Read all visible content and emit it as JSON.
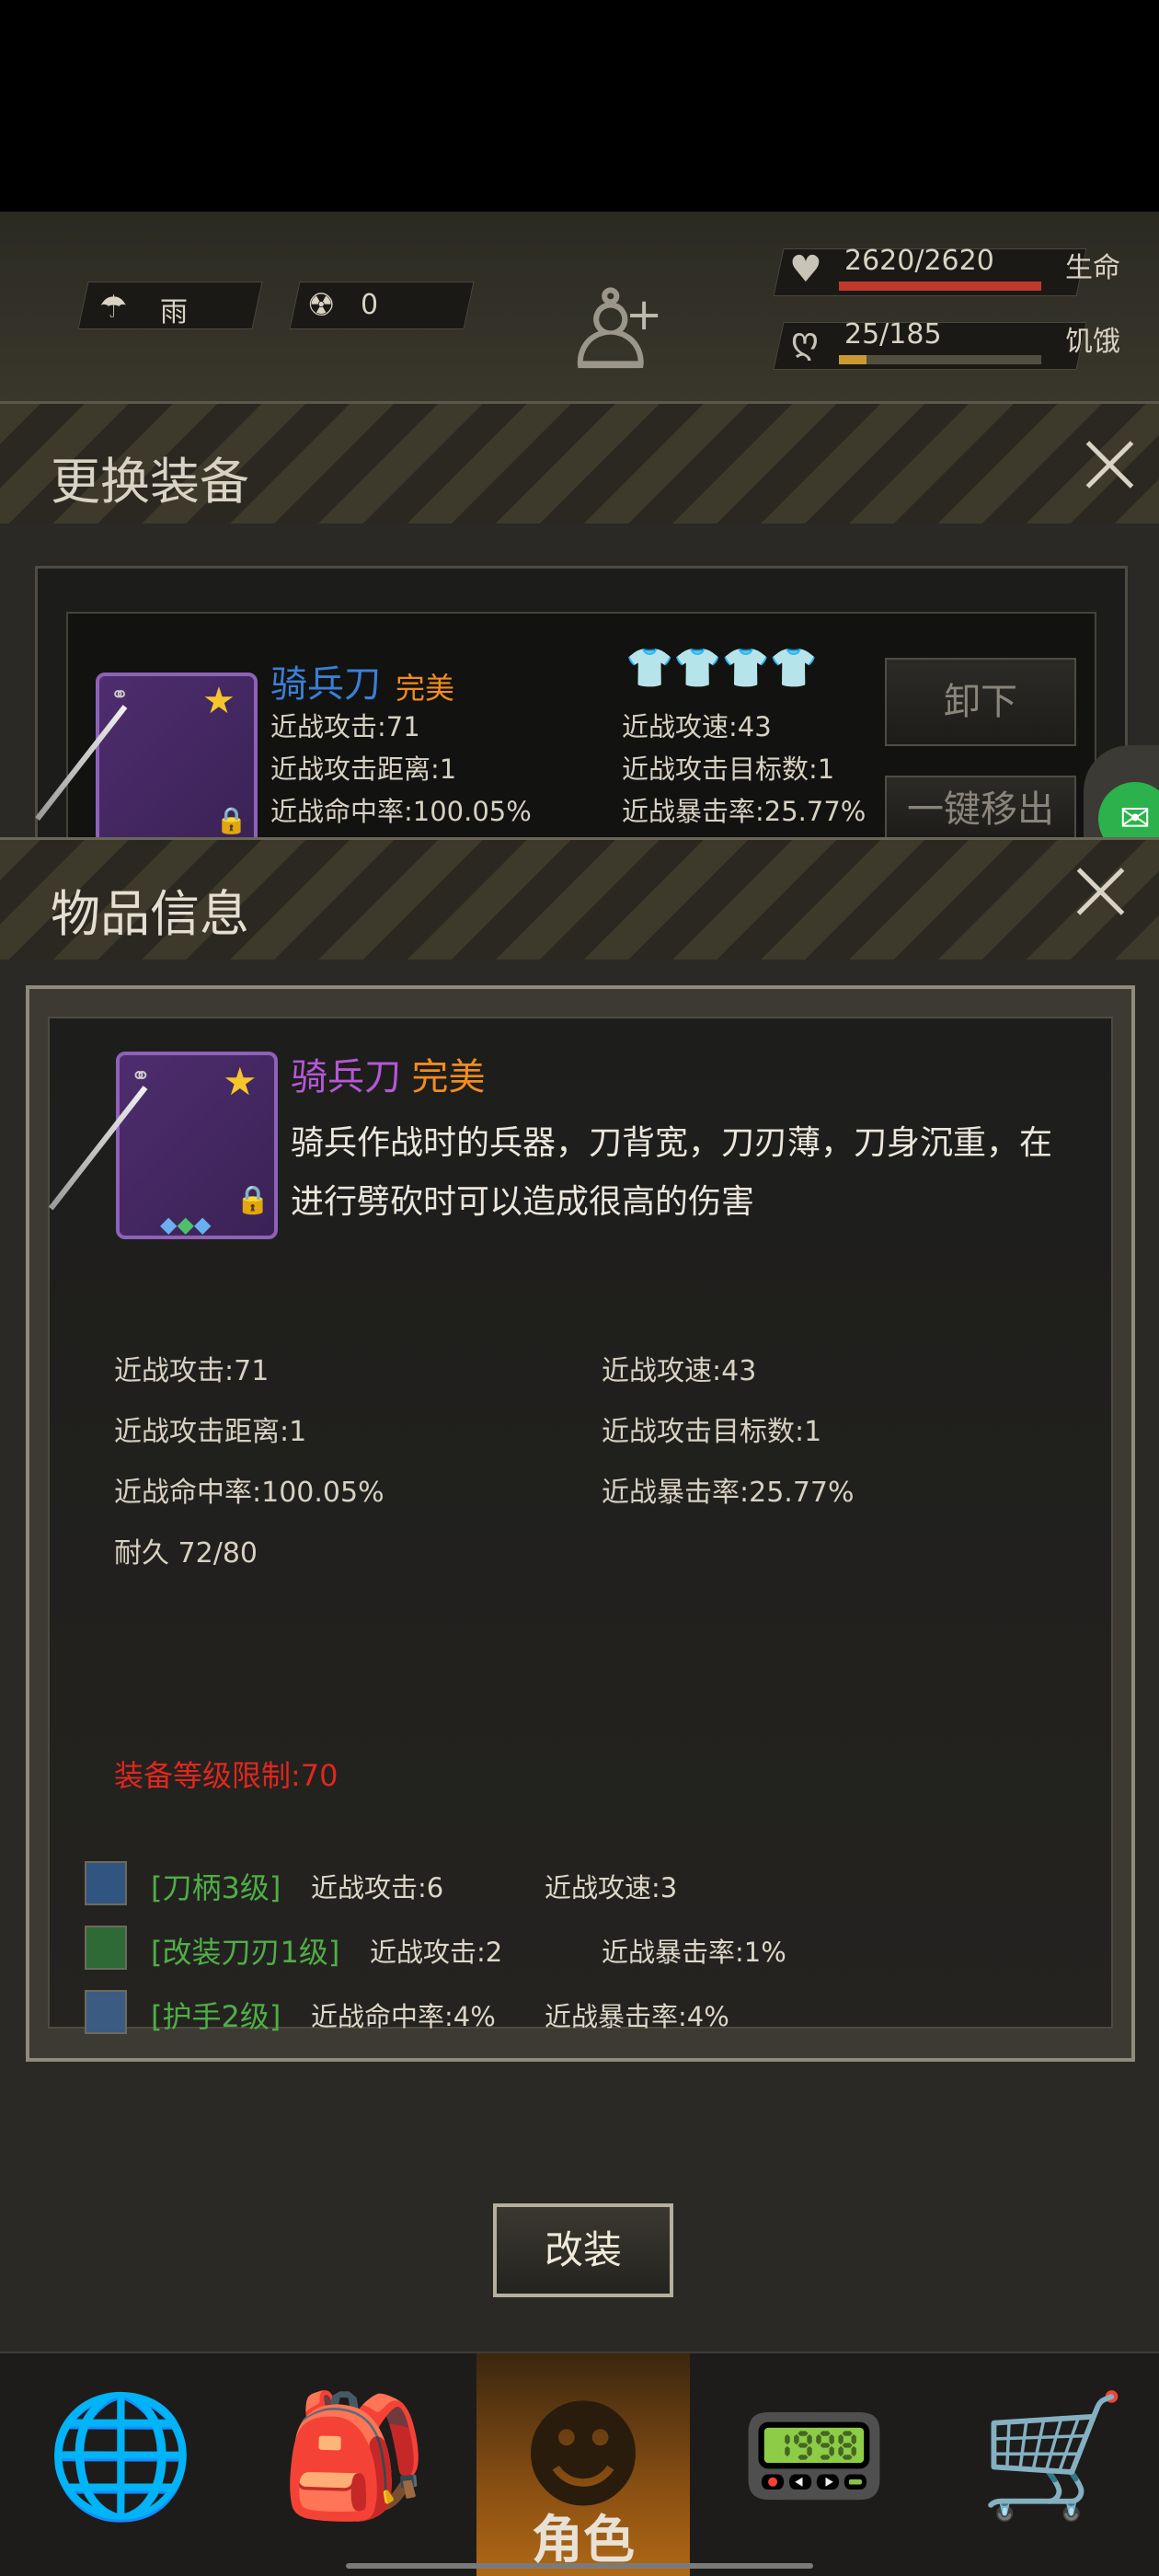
{
  "hud": {
    "weather": "雨",
    "radiation": "0",
    "health": "2620/2620",
    "health_label": "生命",
    "health_fraction": 1.0,
    "hunger": "25/185",
    "hunger_label": "饥饿",
    "hunger_fraction": 0.135
  },
  "equip_panel": {
    "title": "更换装备",
    "item_name": "骑兵刀",
    "item_quality": "完美",
    "stats": [
      "近战攻击:71",
      "近战攻速:43",
      "近战攻击距离:1",
      "近战攻击目标数:1",
      "近战命中率:100.05%",
      "近战暴击率:25.77%"
    ],
    "unequip_button": "卸下",
    "remove_all_button": "一键移出"
  },
  "item_info": {
    "title": "物品信息",
    "name": "骑兵刀",
    "quality": "完美",
    "description": "骑兵作战时的兵器，刀背宽，刀刃薄，刀身沉重，在进行劈砍时可以造成很高的伤害",
    "stats_left": [
      "近战攻击:71",
      "近战攻击距离:1",
      "近战命中率:100.05%",
      "耐久 72/80"
    ],
    "stats_right": [
      "近战攻速:43",
      "近战攻击目标数:1",
      "近战暴击率:25.77%"
    ],
    "level_limit": "装备等级限制:70",
    "mods": [
      {
        "label": "[刀柄3级]",
        "stat1": "近战攻击:6",
        "stat2": "近战攻速:3"
      },
      {
        "label": "[改装刀刃1级]",
        "stat1": "近战攻击:2",
        "stat2": "近战暴击率:1%"
      },
      {
        "label": "[护手2级]",
        "stat1": "近战命中率:4%",
        "stat2": "近战暴击率:4%"
      }
    ],
    "modify_button": "改装"
  },
  "nav": {
    "items": [
      {
        "icon": "globe-icon",
        "label": ""
      },
      {
        "icon": "backpack-icon",
        "label": ""
      },
      {
        "icon": "character-icon",
        "label": "角色"
      },
      {
        "icon": "radio-icon",
        "label": ""
      },
      {
        "icon": "cart-icon",
        "label": ""
      }
    ]
  },
  "colors": {
    "health_bar": "#c1392b",
    "hunger_bar": "#c99a32",
    "quality_orange": "#f28c1e",
    "name_purple": "#b557d6",
    "name_blue": "#3a7fd6",
    "level_limit_red": "#e0271e",
    "mod_green": "#4fae46"
  }
}
